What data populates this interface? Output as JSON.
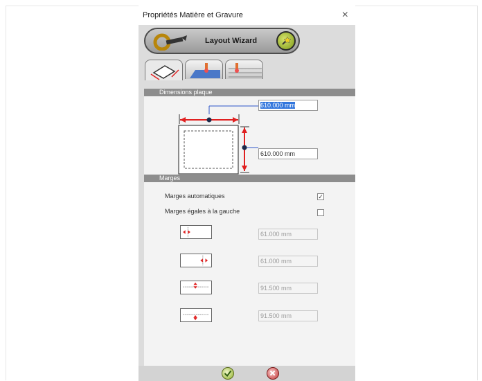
{
  "window": {
    "title": "Propriétés Matière et Gravure",
    "close_symbol": "×"
  },
  "wizard": {
    "label": "Layout Wizard",
    "logo_icon": "gravure-logo-icon",
    "button_icon": "magic-wand-icon"
  },
  "tabs": [
    {
      "icon": "plate-icon",
      "active": true
    },
    {
      "icon": "laser-engrave-icon",
      "active": false
    },
    {
      "icon": "laser-cut-icon",
      "active": false
    }
  ],
  "dimensions": {
    "header": "Dimensions plaque",
    "width_value": "610.000 mm",
    "height_value": "610.000 mm"
  },
  "margins": {
    "header": "Marges",
    "auto_label": "Marges automatiques",
    "auto_checked": "✓",
    "equal_left_label": "Marges égales à la gauche",
    "values": [
      "61.000 mm",
      "61.000 mm",
      "91.500 mm",
      "91.500 mm"
    ]
  },
  "footer": {
    "ok_icon": "ok-check-icon",
    "cancel_icon": "cancel-x-icon"
  },
  "colors": {
    "header_bg": "#8d8d8d",
    "arrow_red": "#e02020",
    "guide_blue": "#2c54c8",
    "selection": "#3377dd"
  }
}
